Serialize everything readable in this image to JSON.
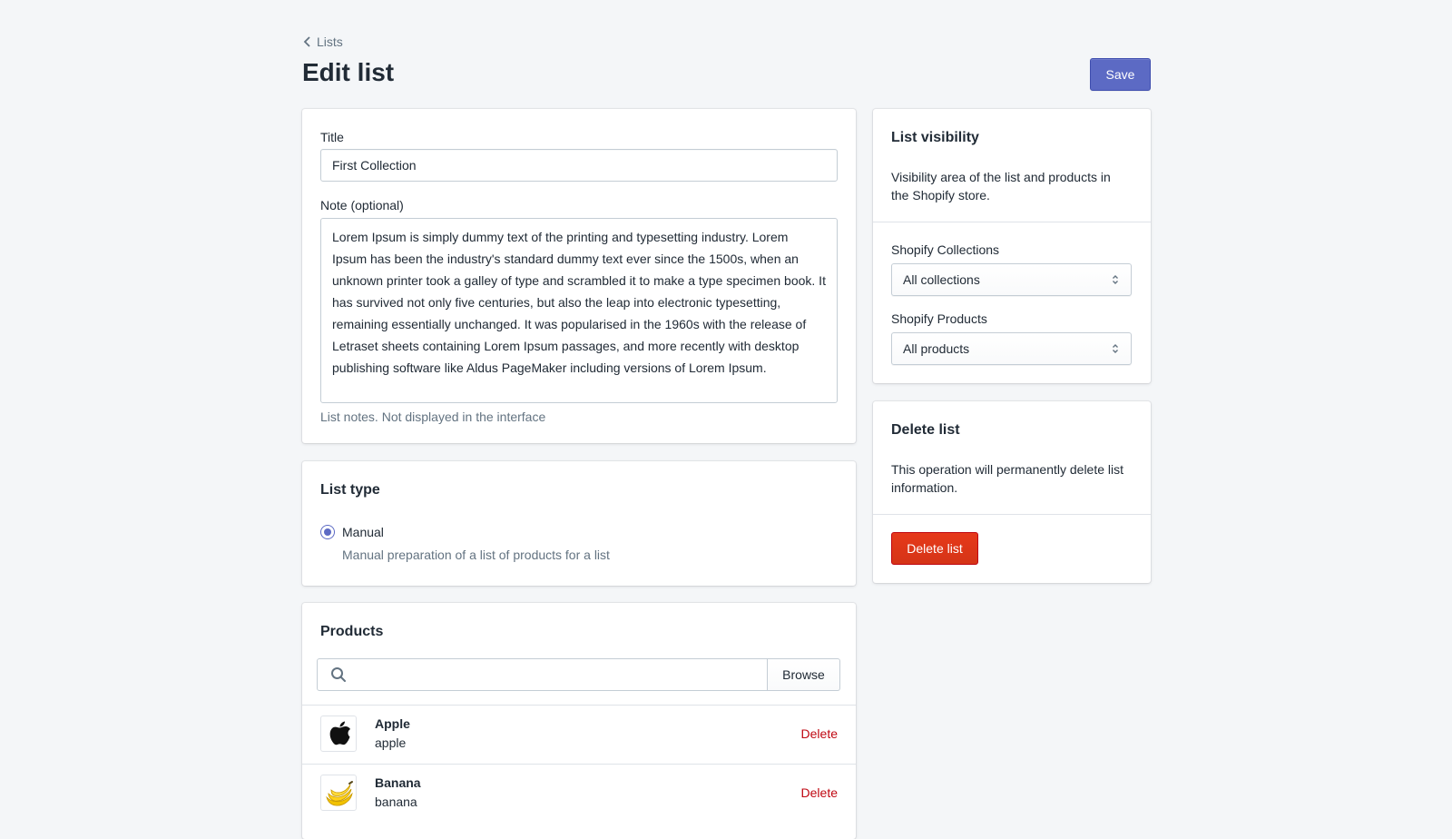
{
  "breadcrumb": {
    "label": "Lists"
  },
  "page": {
    "title": "Edit list",
    "save_label": "Save"
  },
  "details": {
    "title_label": "Title",
    "title_value": "First Collection",
    "note_label": "Note (optional)",
    "note_value": "Lorem Ipsum is simply dummy text of the printing and typesetting industry. Lorem Ipsum has been the industry's standard dummy text ever since the 1500s, when an unknown printer took a galley of type and scrambled it to make a type specimen book. It has survived not only five centuries, but also the leap into electronic typesetting, remaining essentially unchanged. It was popularised in the 1960s with the release of Letraset sheets containing Lorem Ipsum passages, and more recently with desktop publishing software like Aldus PageMaker including versions of Lorem Ipsum.",
    "note_help": "List notes. Not displayed in the interface"
  },
  "list_type": {
    "heading": "List type",
    "option_label": "Manual",
    "option_help": "Manual preparation of a list of products for a list",
    "selected": true
  },
  "products": {
    "heading": "Products",
    "search_placeholder": "",
    "browse_label": "Browse",
    "items": [
      {
        "name": "Apple",
        "handle": "apple",
        "delete_label": "Delete",
        "icon": "apple-logo-icon"
      },
      {
        "name": "Banana",
        "handle": "banana",
        "delete_label": "Delete",
        "icon": "banana-icon"
      }
    ]
  },
  "visibility": {
    "heading": "List visibility",
    "description": "Visibility area of the list and products in the Shopify store.",
    "collections_label": "Shopify Collections",
    "collections_value": "All collections",
    "products_label": "Shopify Products",
    "products_value": "All products"
  },
  "delete_section": {
    "heading": "Delete list",
    "description": "This operation will permanently delete list information.",
    "button_label": "Delete list"
  },
  "colors": {
    "primary": "#5c6ac4",
    "destructive": "#de3618",
    "background": "#f4f6f8"
  }
}
